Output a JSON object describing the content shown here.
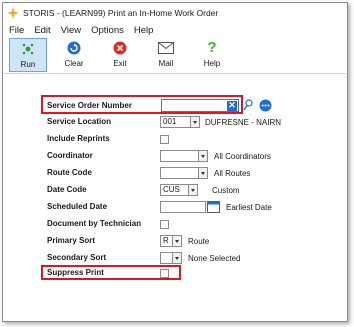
{
  "window": {
    "title": "STORIS - (LEARN99) Print an In-Home Work Order"
  },
  "menu": [
    "File",
    "Edit",
    "View",
    "Options",
    "Help"
  ],
  "toolbar": {
    "buttons": [
      {
        "label": "Run",
        "icon": "run-icon",
        "color": "#2e9a2e"
      },
      {
        "label": "Clear",
        "icon": "clear-icon",
        "color": "#1f6fd0"
      },
      {
        "label": "Exit",
        "icon": "exit-icon",
        "color": "#e02a2a"
      },
      {
        "label": "Mail",
        "icon": "mail-icon",
        "color": "#555555"
      },
      {
        "label": "Help",
        "icon": "help-icon",
        "color": "#3fae2a"
      }
    ]
  },
  "form": {
    "service_order_number": {
      "label": "Service Order Number",
      "value": ""
    },
    "service_location": {
      "label": "Service Location",
      "value": "001",
      "text": "DUFRESNE - NAIRN"
    },
    "include_reprints": {
      "label": "Include Reprints",
      "checked": false
    },
    "coordinator": {
      "label": "Coordinator",
      "value": "",
      "text": "All Coordinators"
    },
    "route_code": {
      "label": "Route Code",
      "value": "",
      "text": "All Routes"
    },
    "date_code": {
      "label": "Date Code",
      "value": "CUS",
      "text": "Custom"
    },
    "scheduled_date": {
      "label": "Scheduled Date",
      "value": "",
      "text": "Earliest Date"
    },
    "document_by_technician": {
      "label": "Document by Technician",
      "checked": false
    },
    "primary_sort": {
      "label": "Primary Sort",
      "value": "R",
      "text": "Route"
    },
    "secondary_sort": {
      "label": "Secondary Sort",
      "value": "",
      "text": "None Selected"
    },
    "suppress_print": {
      "label": "Suppress Print",
      "checked": false
    }
  },
  "colors": {
    "highlight": "#e4141e",
    "accent": "#1f6fd0"
  }
}
